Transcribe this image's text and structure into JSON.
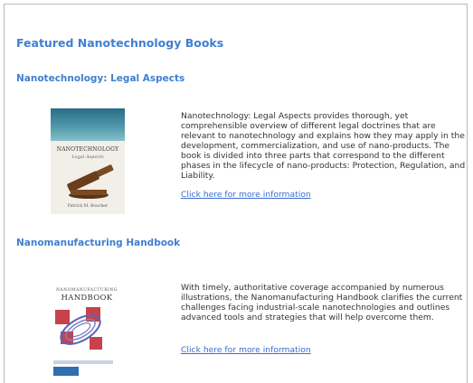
{
  "page": {
    "title": "Featured Nanotechnology Books"
  },
  "books": [
    {
      "title": "Nanotechnology: Legal Aspects",
      "description": "Nanotechnology: Legal Aspects provides thorough, yet comprehensible overview of different legal doctrines that are relevant to nanotechnology and explains how they may apply in the development, commercialization, and use of nano-products. The book is divided into three parts that correspond to the different phases in the lifecycle of nano-products: Protection, Regulation, and Liability.",
      "link_text": "Click here for more information",
      "cover": {
        "title": "NANOTECHNOLOGY",
        "subtitle": "Legal Aspects",
        "author": "Patrick M. Boucher",
        "accent": "#2a6d86"
      }
    },
    {
      "title": "Nanomanufacturing Handbook",
      "description": "With timely, authoritative coverage accompanied by numerous illustrations, the Nanomanufacturing Handbook clarifies the current challenges facing industrial-scale nanotechnologies and outlines advanced tools and strategies that will help overcome them.",
      "link_text": "Click here for more information",
      "cover": {
        "small": "NANOMANUFACTURING",
        "title": "HANDBOOK",
        "accent": "#2f6fb0"
      }
    }
  ],
  "colors": {
    "heading": "#3f7fd0",
    "link": "#3b6ccf",
    "text": "#333333",
    "border": "#b9b9b9"
  }
}
